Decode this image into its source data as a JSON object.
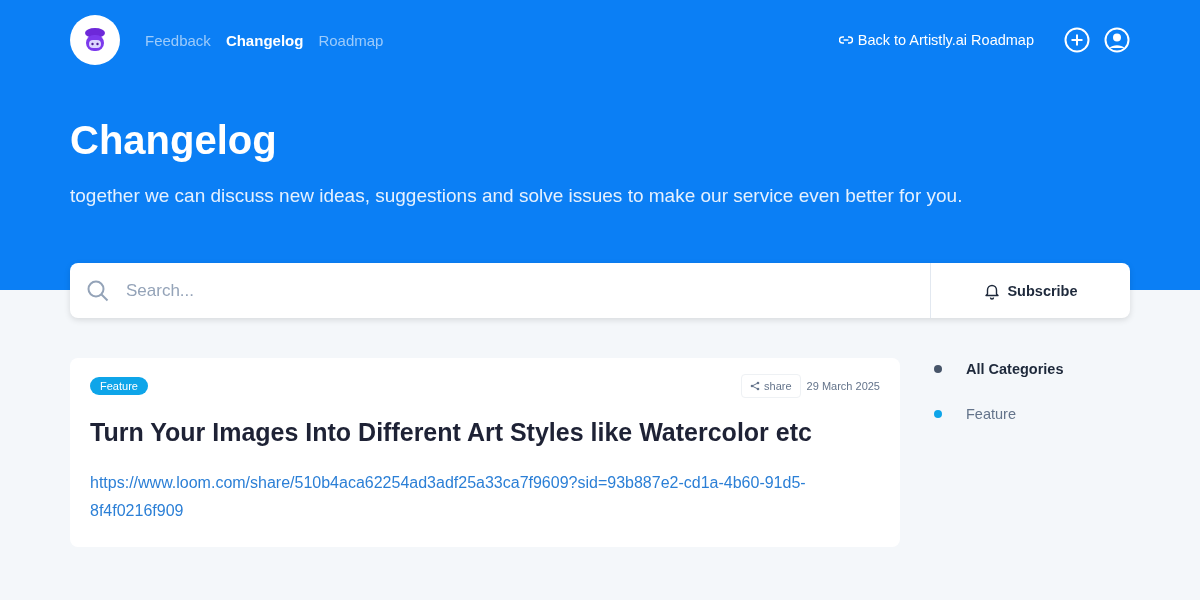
{
  "nav": {
    "items": [
      {
        "label": "Feedback",
        "selected": false
      },
      {
        "label": "Changelog",
        "selected": true
      },
      {
        "label": "Roadmap",
        "selected": false
      }
    ],
    "back_link": "Back to Artistly.ai Roadmap"
  },
  "hero": {
    "title": "Changelog",
    "subtitle": "together we can discuss new ideas, suggestions and solve issues to make our service even better for you."
  },
  "search": {
    "placeholder": "Search...",
    "subscribe": "Subscribe"
  },
  "posts": [
    {
      "tag": "Feature",
      "share": "share",
      "date": "29 March 2025",
      "title": "Turn Your Images Into Different Art Styles like Watercolor etc",
      "link": "https://www.loom.com/share/510b4aca62254ad3adf25a33ca7f9609?sid=93b887e2-cd1a-4b60-91d5-8f4f0216f909"
    }
  ],
  "categories": [
    {
      "label": "All Categories",
      "color": "#475569",
      "selected": true
    },
    {
      "label": "Feature",
      "color": "#0ea5e9",
      "selected": false
    }
  ]
}
